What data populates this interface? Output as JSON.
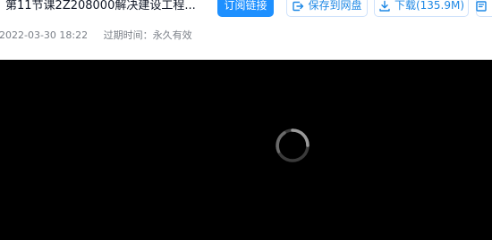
{
  "header": {
    "title": "第11节课2Z208000解决建设工程...",
    "date": "2022-03-30 18:22",
    "expiry": "过期时间：永久有效"
  },
  "buttons": {
    "subscribe": "订阅链接",
    "save": "保存到网盘",
    "download": "下载(135.9M)"
  },
  "icons": {
    "save": "save-to-drive-icon",
    "download": "download-icon",
    "partial": "document-icon"
  },
  "player": {
    "state": "loading"
  },
  "colors": {
    "primary": "#1e90ff",
    "accent_text": "#1e88e5",
    "player_bg": "#000000"
  }
}
